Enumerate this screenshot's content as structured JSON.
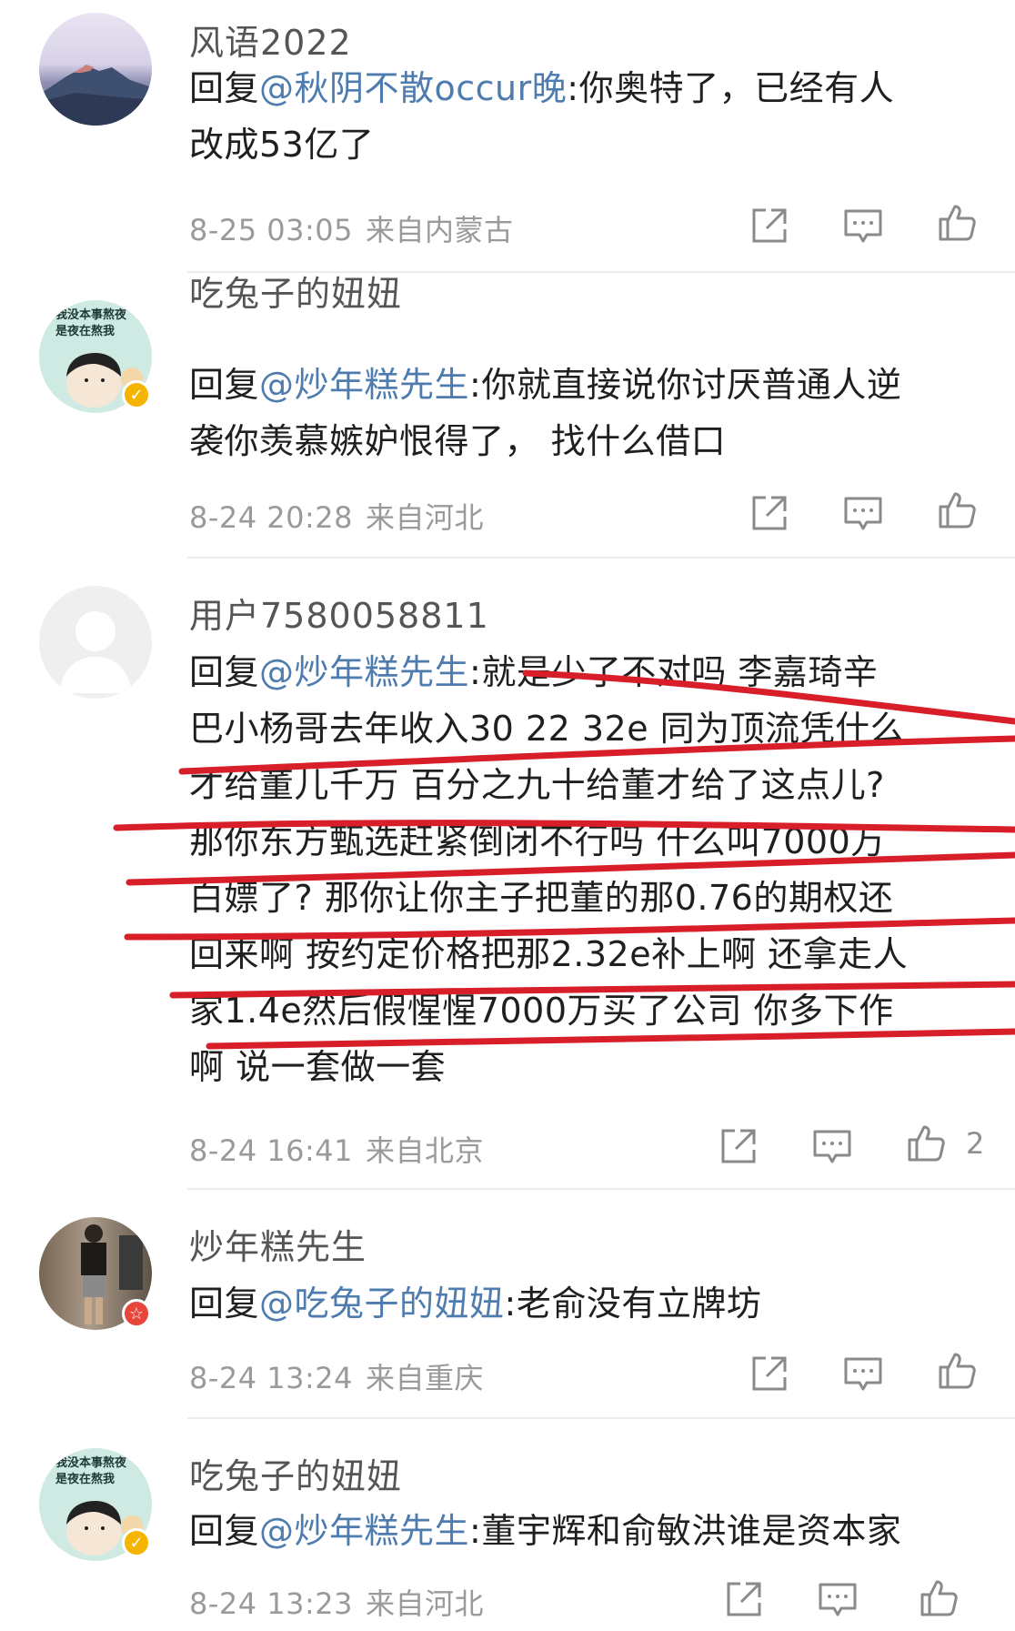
{
  "reply_prefix": "回复",
  "comments": [
    {
      "username": "风语2022",
      "mention": "@秋阴不散occur晚",
      "text_lines": [
        ":你奥特了，已经有人",
        "改成53亿了"
      ],
      "date": "8-25 03:05",
      "location": "来自内蒙古",
      "likes": ""
    },
    {
      "username": "吃兔子的妞妞",
      "mention": "@炒年糕先生",
      "text_lines": [
        ":你就直接说你讨厌普通人逆",
        "袭你羡慕嫉妒恨得了， 找什么借口"
      ],
      "date": "8-24 20:28",
      "location": "来自河北",
      "likes": ""
    },
    {
      "username": "用户7580058811",
      "mention": "@炒年糕先生",
      "text_lines": [
        ":就是少了不对吗 李嘉琦辛",
        "巴小杨哥去年收入30 22 32e 同为顶流凭什么",
        "才给董儿千万 百分之九十给董才给了这点儿?",
        "那你东方甄选赶紧倒闭不行吗 什么叫7000万",
        "白嫖了? 那你让你主子把董的那0.76的期权还",
        "回来啊 按约定价格把那2.32e补上啊 还拿走人",
        "家1.4e然后假惺惺7000万买了公司 你多下作",
        "啊 说一套做一套"
      ],
      "date": "8-24 16:41",
      "location": "来自北京",
      "likes": "2"
    },
    {
      "username": "炒年糕先生",
      "mention": "@吃兔子的妞妞",
      "text_lines": [
        ":老俞没有立牌坊"
      ],
      "date": "8-24 13:24",
      "location": "来自重庆",
      "likes": ""
    },
    {
      "username": "吃兔子的妞妞",
      "mention": "@炒年糕先生",
      "text_lines": [
        ":董宇辉和俞敏洪谁是资本家"
      ],
      "date": "8-24 13:23",
      "location": "来自河北",
      "likes": ""
    }
  ],
  "avatar_caption": [
    "我没本事熬夜",
    "是夜在熬我"
  ],
  "icons": {
    "share": "share-icon",
    "comment": "comment-icon",
    "like": "thumbs-up-icon"
  },
  "colors": {
    "mention": "#4f7cae",
    "vip_badge": "#f5b400",
    "red_badge": "#e8463a",
    "annotation_red": "#d81e28"
  }
}
